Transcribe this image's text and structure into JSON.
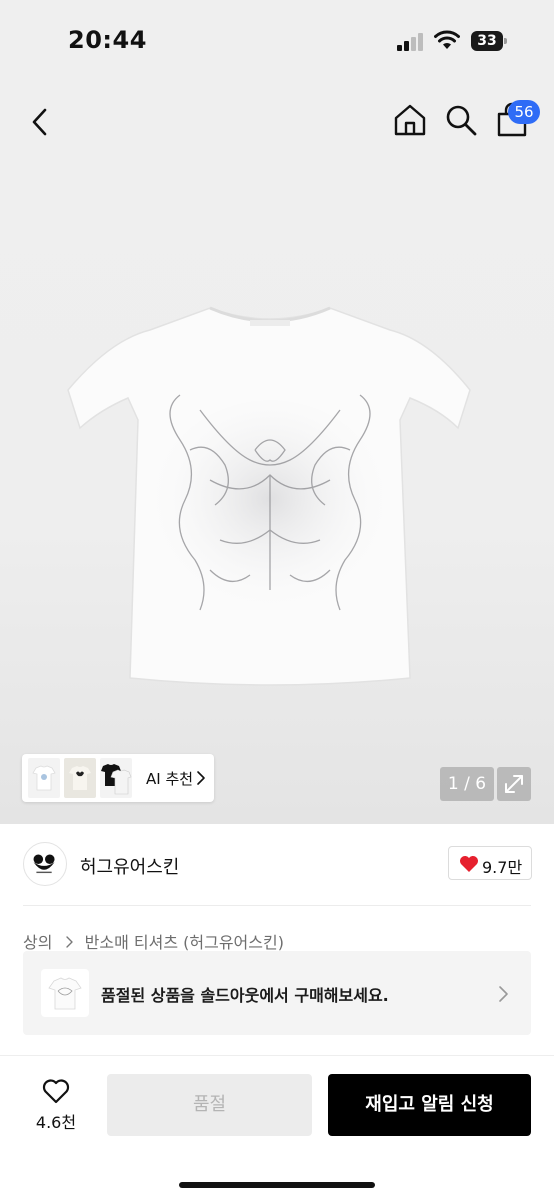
{
  "status_bar": {
    "time": "20:44",
    "battery": "33"
  },
  "header": {
    "back_icon": "chevron-left-icon",
    "home_icon": "home-icon",
    "search_icon": "search-icon",
    "cart_icon": "shopping-bag-icon",
    "cart_badge": "56",
    "badge_color": "#2f6cf6"
  },
  "gallery": {
    "ai_recommend_label": "AI 추천",
    "page_indicator": "1 / 6",
    "expand_icon": "expand-icon"
  },
  "brand": {
    "name": "허그유어스킨",
    "like_count": "9.7만",
    "heart_color": "#e6202e"
  },
  "breadcrumb": {
    "category": "상의",
    "subcategory": "반소매 티셔츠 (허그유어스킨)"
  },
  "soldout_banner": {
    "message": "품절된 상품을 솔드아웃에서 구매해보세요."
  },
  "bottom_bar": {
    "wish_count": "4.6천",
    "soldout_label": "품절",
    "restock_label": "재입고 알림 신청"
  }
}
